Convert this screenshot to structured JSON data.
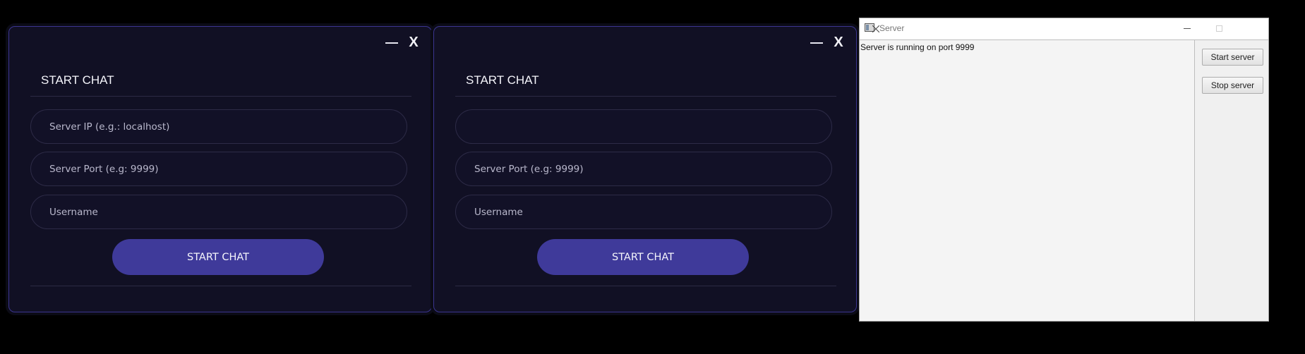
{
  "chat_windows": [
    {
      "title": "START CHAT",
      "close_label": "X",
      "fields": [
        {
          "placeholder": "Server IP (e.g.: localhost)",
          "value": ""
        },
        {
          "placeholder": "Server Port (e.g: 9999)",
          "value": ""
        },
        {
          "placeholder": "Username",
          "value": ""
        }
      ],
      "button_label": "START CHAT"
    },
    {
      "title": "START CHAT",
      "close_label": "X",
      "fields": [
        {
          "placeholder": "",
          "value": ""
        },
        {
          "placeholder": "Server Port (e.g: 9999)",
          "value": ""
        },
        {
          "placeholder": "Username",
          "value": ""
        }
      ],
      "button_label": "START CHAT"
    }
  ],
  "server_window": {
    "title": "Server",
    "log_text": "Server is running on port 9999",
    "start_button": "Start server",
    "stop_button": "Stop server"
  },
  "colors": {
    "chat_background": "#111024",
    "chat_border": "#3b3590",
    "accent_button": "#3f3a9a"
  },
  "icons": {
    "minimize": "minimize-icon",
    "close": "close-icon",
    "app": "window-app-icon"
  }
}
